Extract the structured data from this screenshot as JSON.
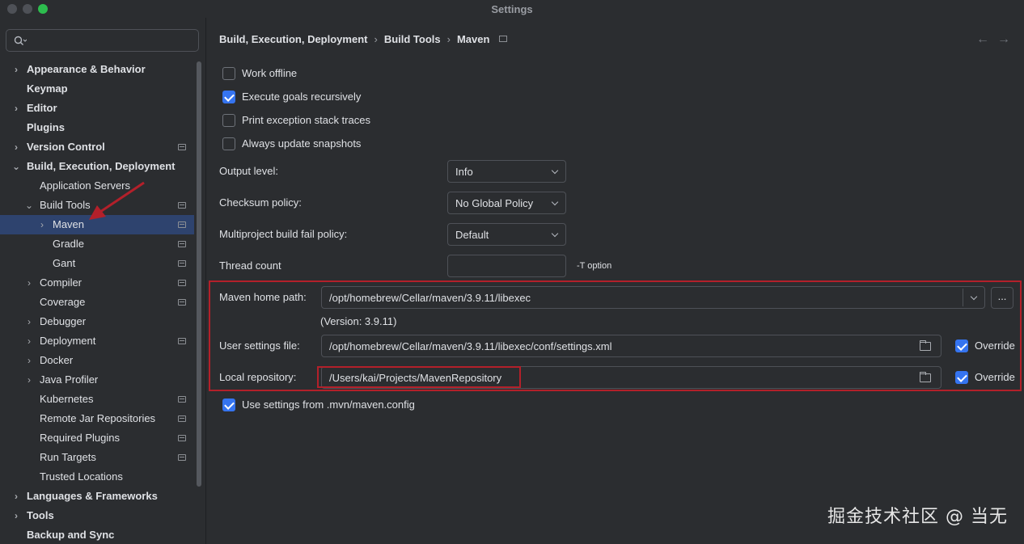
{
  "window": {
    "title": "Settings"
  },
  "search": {
    "placeholder": ""
  },
  "sidebar": {
    "items": [
      {
        "label": "Appearance & Behavior",
        "bold": true,
        "chevron": "›"
      },
      {
        "label": "Keymap",
        "bold": true
      },
      {
        "label": "Editor",
        "bold": true,
        "chevron": "›"
      },
      {
        "label": "Plugins",
        "bold": true
      },
      {
        "label": "Version Control",
        "bold": true,
        "chevron": "›",
        "project_icon": true
      },
      {
        "label": "Build, Execution, Deployment",
        "bold": true,
        "chevron": "⌄"
      },
      {
        "label": "Application Servers"
      },
      {
        "label": "Build Tools",
        "chevron": "⌄",
        "project_icon": true
      },
      {
        "label": "Maven",
        "chevron": "›",
        "project_icon": true,
        "selected": true
      },
      {
        "label": "Gradle",
        "project_icon": true
      },
      {
        "label": "Gant",
        "project_icon": true
      },
      {
        "label": "Compiler",
        "chevron": "›",
        "project_icon": true
      },
      {
        "label": "Coverage",
        "project_icon": true
      },
      {
        "label": "Debugger",
        "chevron": "›"
      },
      {
        "label": "Deployment",
        "chevron": "›",
        "project_icon": true
      },
      {
        "label": "Docker",
        "chevron": "›"
      },
      {
        "label": "Java Profiler",
        "chevron": "›"
      },
      {
        "label": "Kubernetes",
        "project_icon": true
      },
      {
        "label": "Remote Jar Repositories",
        "project_icon": true
      },
      {
        "label": "Required Plugins",
        "project_icon": true
      },
      {
        "label": "Run Targets",
        "project_icon": true
      },
      {
        "label": "Trusted Locations"
      },
      {
        "label": "Languages & Frameworks",
        "bold": true,
        "chevron": "›"
      },
      {
        "label": "Tools",
        "bold": true,
        "chevron": "›"
      },
      {
        "label": "Backup and Sync",
        "bold": true
      }
    ]
  },
  "breadcrumb": {
    "items": [
      "Build, Execution, Deployment",
      "Build Tools",
      "Maven"
    ],
    "separator": "›"
  },
  "nav": {
    "back": "←",
    "forward": "→"
  },
  "options": [
    {
      "label": "Work offline",
      "checked": false
    },
    {
      "label": "Execute goals recursively",
      "checked": true
    },
    {
      "label": "Print exception stack traces",
      "checked": false
    },
    {
      "label": "Always update snapshots",
      "checked": false
    }
  ],
  "output_level": {
    "label": "Output level:",
    "value": "Info"
  },
  "checksum_policy": {
    "label": "Checksum policy:",
    "value": "No Global Policy"
  },
  "multiproject_policy": {
    "label": "Multiproject build fail policy:",
    "value": "Default"
  },
  "thread_count": {
    "label": "Thread count",
    "value": "",
    "hint": "-T option"
  },
  "maven_home": {
    "label": "Maven home path:",
    "value": "/opt/homebrew/Cellar/maven/3.9.11/libexec",
    "version": "(Version: 3.9.11)",
    "browse": "..."
  },
  "user_settings": {
    "label": "User settings file:",
    "value": "/opt/homebrew/Cellar/maven/3.9.11/libexec/conf/settings.xml",
    "override_label": "Override",
    "override": true
  },
  "local_repo": {
    "label": "Local repository:",
    "value": "/Users/kai/Projects/MavenRepository",
    "override_label": "Override",
    "override": true
  },
  "mvn_config": {
    "label": "Use settings from .mvn/maven.config",
    "checked": true
  },
  "watermark": "掘金技术社区 @ 当无",
  "colors": {
    "accent": "#3574f0",
    "selection": "#2e436e",
    "annotation": "#b3202a",
    "background": "#2b2d30"
  }
}
